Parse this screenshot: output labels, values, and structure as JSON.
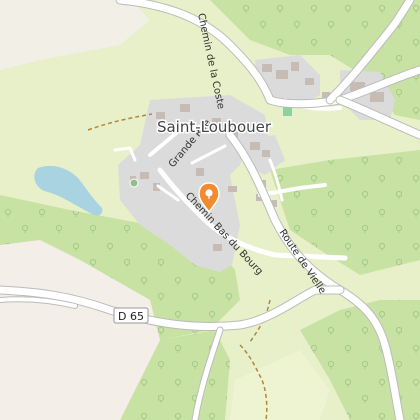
{
  "map": {
    "place": "Saint-Loubouer",
    "roads": {
      "grande_rue": "Grande Rue",
      "chemin_bas": "Chemin Bas du Bourg",
      "route_vielle": "Route de Vielle",
      "route_top": "Chemin de la Coste",
      "d65_shield": "D 65"
    },
    "colors": {
      "meadow": "#e6f0c6",
      "forest": "#c9e2a6",
      "urban": "#dedcdc",
      "water": "#aad3df",
      "road": "#ffffff",
      "marker": "#f08b2f"
    },
    "marker_icon": "map-pin-icon"
  }
}
